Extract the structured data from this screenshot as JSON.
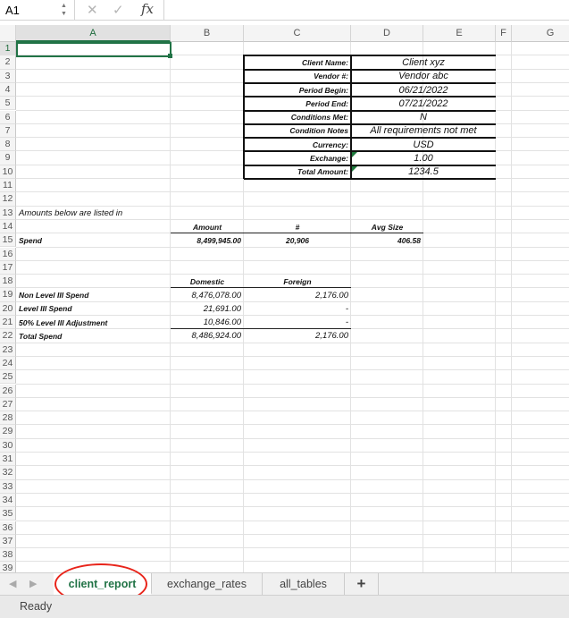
{
  "formula_bar": {
    "name_box": "A1",
    "cancel_icon": "✕",
    "enter_icon": "✓",
    "fx_label": "fx",
    "content": ""
  },
  "columns": [
    "A",
    "B",
    "C",
    "D",
    "E",
    "F",
    "G"
  ],
  "rows": [
    "1",
    "2",
    "3",
    "4",
    "5",
    "6",
    "7",
    "8",
    "9",
    "10",
    "11",
    "12",
    "13",
    "14",
    "15",
    "16",
    "17",
    "18",
    "19",
    "20",
    "21",
    "22",
    "23",
    "24",
    "25",
    "26",
    "27",
    "28",
    "29",
    "30",
    "31",
    "32",
    "33",
    "34",
    "35",
    "36",
    "37",
    "38",
    "39"
  ],
  "info_table": [
    {
      "label": "Client Name:",
      "value": "Client xyz"
    },
    {
      "label": "Vendor #:",
      "value": "Vendor abc"
    },
    {
      "label": "Period Begin:",
      "value": "06/21/2022"
    },
    {
      "label": "Period End:",
      "value": "07/21/2022"
    },
    {
      "label": "Conditions Met:",
      "value": "N"
    },
    {
      "label": "Condition Notes",
      "value": "All requirements not met"
    },
    {
      "label": "Currency:",
      "value": "USD"
    },
    {
      "label": "Exchange:",
      "value": "1.00"
    },
    {
      "label": "Total Amount:",
      "value": "1234.5"
    }
  ],
  "note": "Amounts below are listed in",
  "summary": {
    "headers": [
      "Amount",
      "#",
      "Avg Size"
    ],
    "row_label": "Spend",
    "values": [
      "8,499,945.00",
      "20,906",
      "406.58"
    ]
  },
  "breakdown": {
    "headers": [
      "Domestic",
      "Foreign"
    ],
    "rows": [
      {
        "label": "Non Level III Spend",
        "domestic": "8,476,078.00",
        "foreign": "2,176.00"
      },
      {
        "label": "Level III Spend",
        "domestic": "21,691.00",
        "foreign": "-"
      },
      {
        "label": "50% Level III Adjustment",
        "domestic": "10,846.00",
        "foreign": "-"
      },
      {
        "label": "Total  Spend",
        "domestic": "8,486,924.00",
        "foreign": "2,176.00"
      }
    ]
  },
  "sheet_tabs": [
    {
      "label": "client_report",
      "active": true
    },
    {
      "label": "exchange_rates",
      "active": false
    },
    {
      "label": "all_tables",
      "active": false
    }
  ],
  "add_sheet": "+",
  "status": "Ready"
}
